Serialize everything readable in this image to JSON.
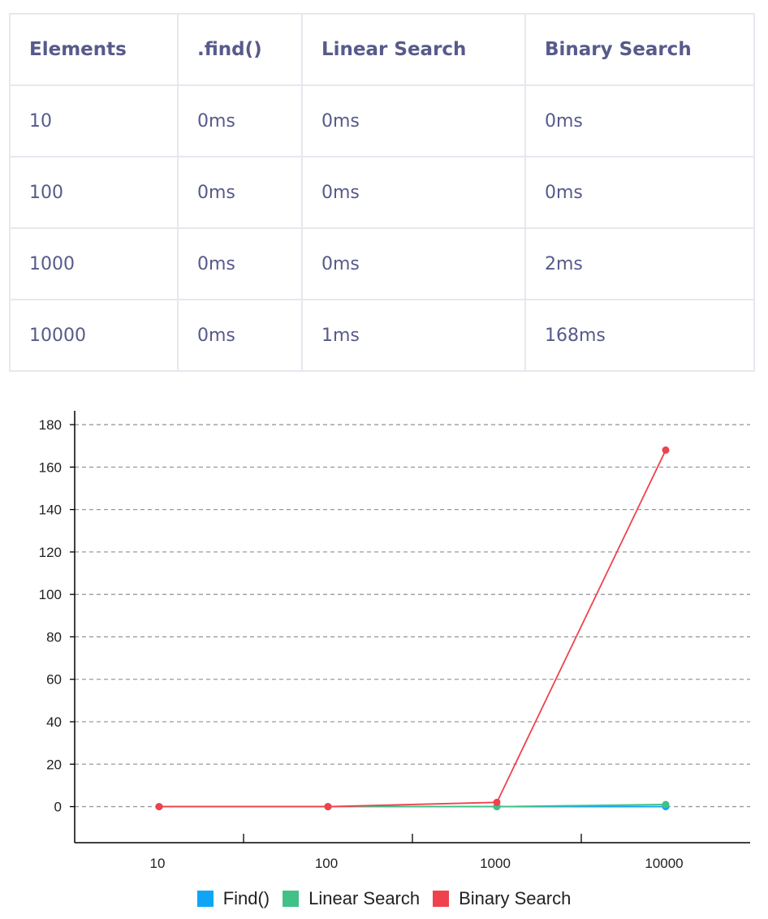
{
  "table": {
    "headers": [
      "Elements",
      ".find()",
      "Linear Search",
      "Binary Search"
    ],
    "rows": [
      [
        "10",
        "0ms",
        "0ms",
        "0ms"
      ],
      [
        "100",
        "0ms",
        "0ms",
        "0ms"
      ],
      [
        "1000",
        "0ms",
        "0ms",
        "2ms"
      ],
      [
        "10000",
        "0ms",
        "1ms",
        "168ms"
      ]
    ]
  },
  "chart_data": {
    "type": "line",
    "categories": [
      "10",
      "100",
      "1000",
      "10000"
    ],
    "series": [
      {
        "name": "Find()",
        "values": [
          0,
          0,
          0,
          0
        ],
        "color": "#0ea5f7"
      },
      {
        "name": "Linear Search",
        "values": [
          0,
          0,
          0,
          1
        ],
        "color": "#41c187"
      },
      {
        "name": "Binary Search",
        "values": [
          0,
          0,
          2,
          168
        ],
        "color": "#f0424d"
      }
    ],
    "ylim": [
      -17,
      185
    ],
    "yticks": [
      0,
      20,
      40,
      60,
      80,
      100,
      120,
      140,
      160,
      180
    ],
    "grid": "horizontal dashed",
    "legend": "bottom"
  }
}
